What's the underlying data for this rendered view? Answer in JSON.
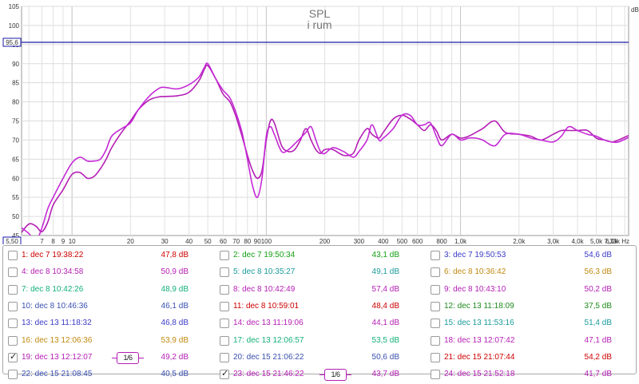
{
  "chart_data": {
    "type": "line",
    "title": "SPL",
    "subtitle": "i rum",
    "ylabel": "dB",
    "xunit": "Hz",
    "ylim": [
      45,
      105
    ],
    "xlim": [
      5.5,
      7330
    ],
    "xscale": "log",
    "y_ticks": [
      50,
      55,
      60,
      65,
      70,
      75,
      80,
      85,
      90,
      95,
      100,
      105
    ],
    "y_ticks_bottom": 45,
    "x_tick_labels": [
      {
        "v": 7,
        "t": "7"
      },
      {
        "v": 8,
        "t": "8"
      },
      {
        "v": 9,
        "t": "9"
      },
      {
        "v": 10,
        "t": "10"
      },
      {
        "v": 20,
        "t": "20"
      },
      {
        "v": 30,
        "t": "30"
      },
      {
        "v": 40,
        "t": "40"
      },
      {
        "v": 50,
        "t": "50"
      },
      {
        "v": 60,
        "t": "60"
      },
      {
        "v": 70,
        "t": "70"
      },
      {
        "v": 80,
        "t": "80"
      },
      {
        "v": 90,
        "t": "90"
      },
      {
        "v": 100,
        "t": "100"
      },
      {
        "v": 200,
        "t": "200"
      },
      {
        "v": 300,
        "t": "300"
      },
      {
        "v": 400,
        "t": "400"
      },
      {
        "v": 500,
        "t": "500"
      },
      {
        "v": 600,
        "t": "600"
      },
      {
        "v": 800,
        "t": "800"
      },
      {
        "v": 1000,
        "t": "1,0k"
      },
      {
        "v": 2000,
        "t": "2,0k"
      },
      {
        "v": 3000,
        "t": "3,0k"
      },
      {
        "v": 4000,
        "t": "4,0k"
      },
      {
        "v": 5000,
        "t": "5,0k"
      },
      {
        "v": 6000,
        "t": "6,0k"
      }
    ],
    "x_end_label": "7,33k",
    "x_start_readout": "5,50",
    "cursor_level": 95.6,
    "cursor_label": "95,6",
    "cursor_color": "#1a1aa8",
    "grid": true,
    "series": [
      {
        "name": "19: dec 13 12:12:07",
        "color": "#b41eb4",
        "x": [
          5.5,
          6,
          6.5,
          7,
          7.5,
          8,
          9,
          10,
          11,
          12,
          13,
          14,
          15,
          16,
          18,
          20,
          22,
          25,
          28,
          30,
          35,
          40,
          45,
          48,
          50,
          55,
          60,
          65,
          70,
          75,
          80,
          85,
          90,
          95,
          100,
          105,
          110,
          120,
          130,
          140,
          150,
          160,
          170,
          180,
          190,
          200,
          220,
          250,
          280,
          300,
          330,
          350,
          380,
          400,
          450,
          500,
          550,
          600,
          650,
          700,
          750,
          800,
          900,
          1000,
          1100,
          1200,
          1300,
          1500,
          1700,
          2000,
          2300,
          2600,
          3000,
          3300,
          3600,
          4000,
          4500,
          5000,
          5500,
          6000,
          6500,
          7330
        ],
        "y": [
          45.8,
          48,
          47.5,
          46,
          48.5,
          53,
          57,
          61,
          61.5,
          60,
          60.5,
          62.5,
          65,
          68,
          72,
          75,
          78,
          80.5,
          81.3,
          81.4,
          81.6,
          82.5,
          85.5,
          88.5,
          89.5,
          86,
          82,
          80,
          76,
          71,
          66,
          62,
          60,
          62,
          70,
          75,
          74.5,
          68.5,
          67,
          67.5,
          70,
          73,
          70,
          67.5,
          66.5,
          67.5,
          67.5,
          66,
          66.5,
          70,
          73,
          71.5,
          70.5,
          72,
          75.5,
          76.5,
          75.5,
          74,
          72.5,
          74,
          72.5,
          70,
          71.5,
          70.5,
          71,
          72,
          73,
          75,
          72,
          71.5,
          71,
          70,
          71.5,
          72.5,
          72.5,
          72.5,
          72.5,
          70.5,
          70,
          69.5,
          70,
          71.2
        ]
      },
      {
        "name": "23: dec 15 21:46:22",
        "color": "#c42ad6",
        "x": [
          5.5,
          6,
          6.5,
          7,
          7.5,
          8,
          9,
          10,
          11,
          12,
          13,
          14,
          15,
          16,
          18,
          20,
          22,
          25,
          28,
          30,
          35,
          40,
          45,
          48,
          50,
          55,
          60,
          65,
          70,
          75,
          80,
          85,
          90,
          95,
          100,
          105,
          110,
          120,
          130,
          140,
          150,
          160,
          170,
          180,
          190,
          200,
          220,
          250,
          280,
          300,
          330,
          350,
          380,
          400,
          450,
          500,
          550,
          600,
          650,
          700,
          750,
          800,
          900,
          1000,
          1100,
          1200,
          1300,
          1500,
          1700,
          2000,
          2300,
          2600,
          3000,
          3300,
          3600,
          4000,
          4500,
          5000,
          5500,
          6000,
          6500,
          7330
        ],
        "y": [
          47,
          45.5,
          43.5,
          47,
          52,
          55,
          60,
          64,
          65.5,
          64.5,
          64.5,
          65,
          67.5,
          71,
          73,
          74.5,
          78,
          81.5,
          83.5,
          83.8,
          83.4,
          84.5,
          86.5,
          89,
          90,
          86,
          83,
          81,
          77,
          72,
          65,
          58,
          55,
          60,
          71,
          73.5,
          71.5,
          67,
          67.5,
          69,
          70.5,
          72,
          73.5,
          70,
          67,
          66.5,
          68,
          67,
          65.5,
          67,
          70,
          74,
          70,
          70.5,
          73,
          76.5,
          76.5,
          74,
          74,
          74.5,
          71,
          68.5,
          71.5,
          70,
          70.5,
          70.5,
          70,
          68.5,
          71.5,
          71.5,
          70.5,
          70,
          69.5,
          71,
          73.5,
          72.5,
          71.5,
          71,
          70,
          69.5,
          69.5,
          70.7
        ]
      }
    ]
  },
  "legend": {
    "colors": {
      "red": "#cc0000",
      "green": "#13a013",
      "blue": "#3a3ac8",
      "magenta": "#b41eb4",
      "olive": "#c08a10",
      "teal": "#1a9a9a",
      "mint": "#14b078",
      "dblue": "#3a50b0",
      "darkgreen": "#1e8a1e"
    },
    "items": [
      {
        "label": "1: dec 7 19:38:22",
        "value": "47,8 dB",
        "color": "#cc0000",
        "checked": false
      },
      {
        "label": "2: dec 7 19:50:34",
        "value": "43,1 dB",
        "color": "#13a013",
        "checked": false
      },
      {
        "label": "3: dec 7 19:50:53",
        "value": "54,6 dB",
        "color": "#3a3ac8",
        "checked": false
      },
      {
        "label": "4: dec 8 10:34:58",
        "value": "50,9 dB",
        "color": "#b41eb4",
        "checked": false
      },
      {
        "label": "5: dec 8 10:35:27",
        "value": "49,1 dB",
        "color": "#1a9a9a",
        "checked": false
      },
      {
        "label": "6: dec 8 10:36:42",
        "value": "56,3 dB",
        "color": "#c08a10",
        "checked": false
      },
      {
        "label": "7: dec 8 10:42:26",
        "value": "48,9 dB",
        "color": "#14b078",
        "checked": false
      },
      {
        "label": "8: dec 8 10:42:49",
        "value": "57,4 dB",
        "color": "#b41eb4",
        "checked": false
      },
      {
        "label": "9: dec 8 10:43:10",
        "value": "50,2 dB",
        "color": "#b41eb4",
        "checked": false
      },
      {
        "label": "10: dec 8 10:46:36",
        "value": "46,1 dB",
        "color": "#3a50b0",
        "checked": false
      },
      {
        "label": "11: dec 8 10:59:01",
        "value": "48,4 dB",
        "color": "#cc0000",
        "checked": false
      },
      {
        "label": "12: dec 13 11:18:09",
        "value": "37,5 dB",
        "color": "#1e8a1e",
        "checked": false
      },
      {
        "label": "13: dec 13 11:18:32",
        "value": "46,8 dB",
        "color": "#3a3ac8",
        "checked": false
      },
      {
        "label": "14: dec 13 11:19:06",
        "value": "44,1 dB",
        "color": "#b41eb4",
        "checked": false
      },
      {
        "label": "15: dec 13 11:53:16",
        "value": "51,4 dB",
        "color": "#1a9a9a",
        "checked": false
      },
      {
        "label": "16: dec 13 12:06:36",
        "value": "53,9 dB",
        "color": "#c08a10",
        "checked": false
      },
      {
        "label": "17: dec 13 12:06:57",
        "value": "53,5 dB",
        "color": "#14b078",
        "checked": false
      },
      {
        "label": "18: dec 13 12:07:42",
        "value": "47,1 dB",
        "color": "#b41eb4",
        "checked": false
      },
      {
        "label": "19: dec 13 12:12:07",
        "value": "49,2 dB",
        "color": "#b41eb4",
        "checked": true,
        "smoothing": "1/6"
      },
      {
        "label": "20: dec 15 21:06:22",
        "value": "50,6 dB",
        "color": "#3a50b0",
        "checked": false
      },
      {
        "label": "21: dec 15 21:07:44",
        "value": "54,2 dB",
        "color": "#cc0000",
        "checked": false
      },
      {
        "label": "22: dec 15 21:08:45",
        "value": "40,5 dB",
        "color": "#3a50b0",
        "checked": false
      },
      {
        "label": "23: dec 15 21:46:22",
        "value": "43,7 dB",
        "color": "#b41eb4",
        "checked": true,
        "smoothing": "1/6"
      },
      {
        "label": "24: dec 15 21:52:18",
        "value": "41,7 dB",
        "color": "#b41eb4",
        "checked": false
      }
    ]
  }
}
